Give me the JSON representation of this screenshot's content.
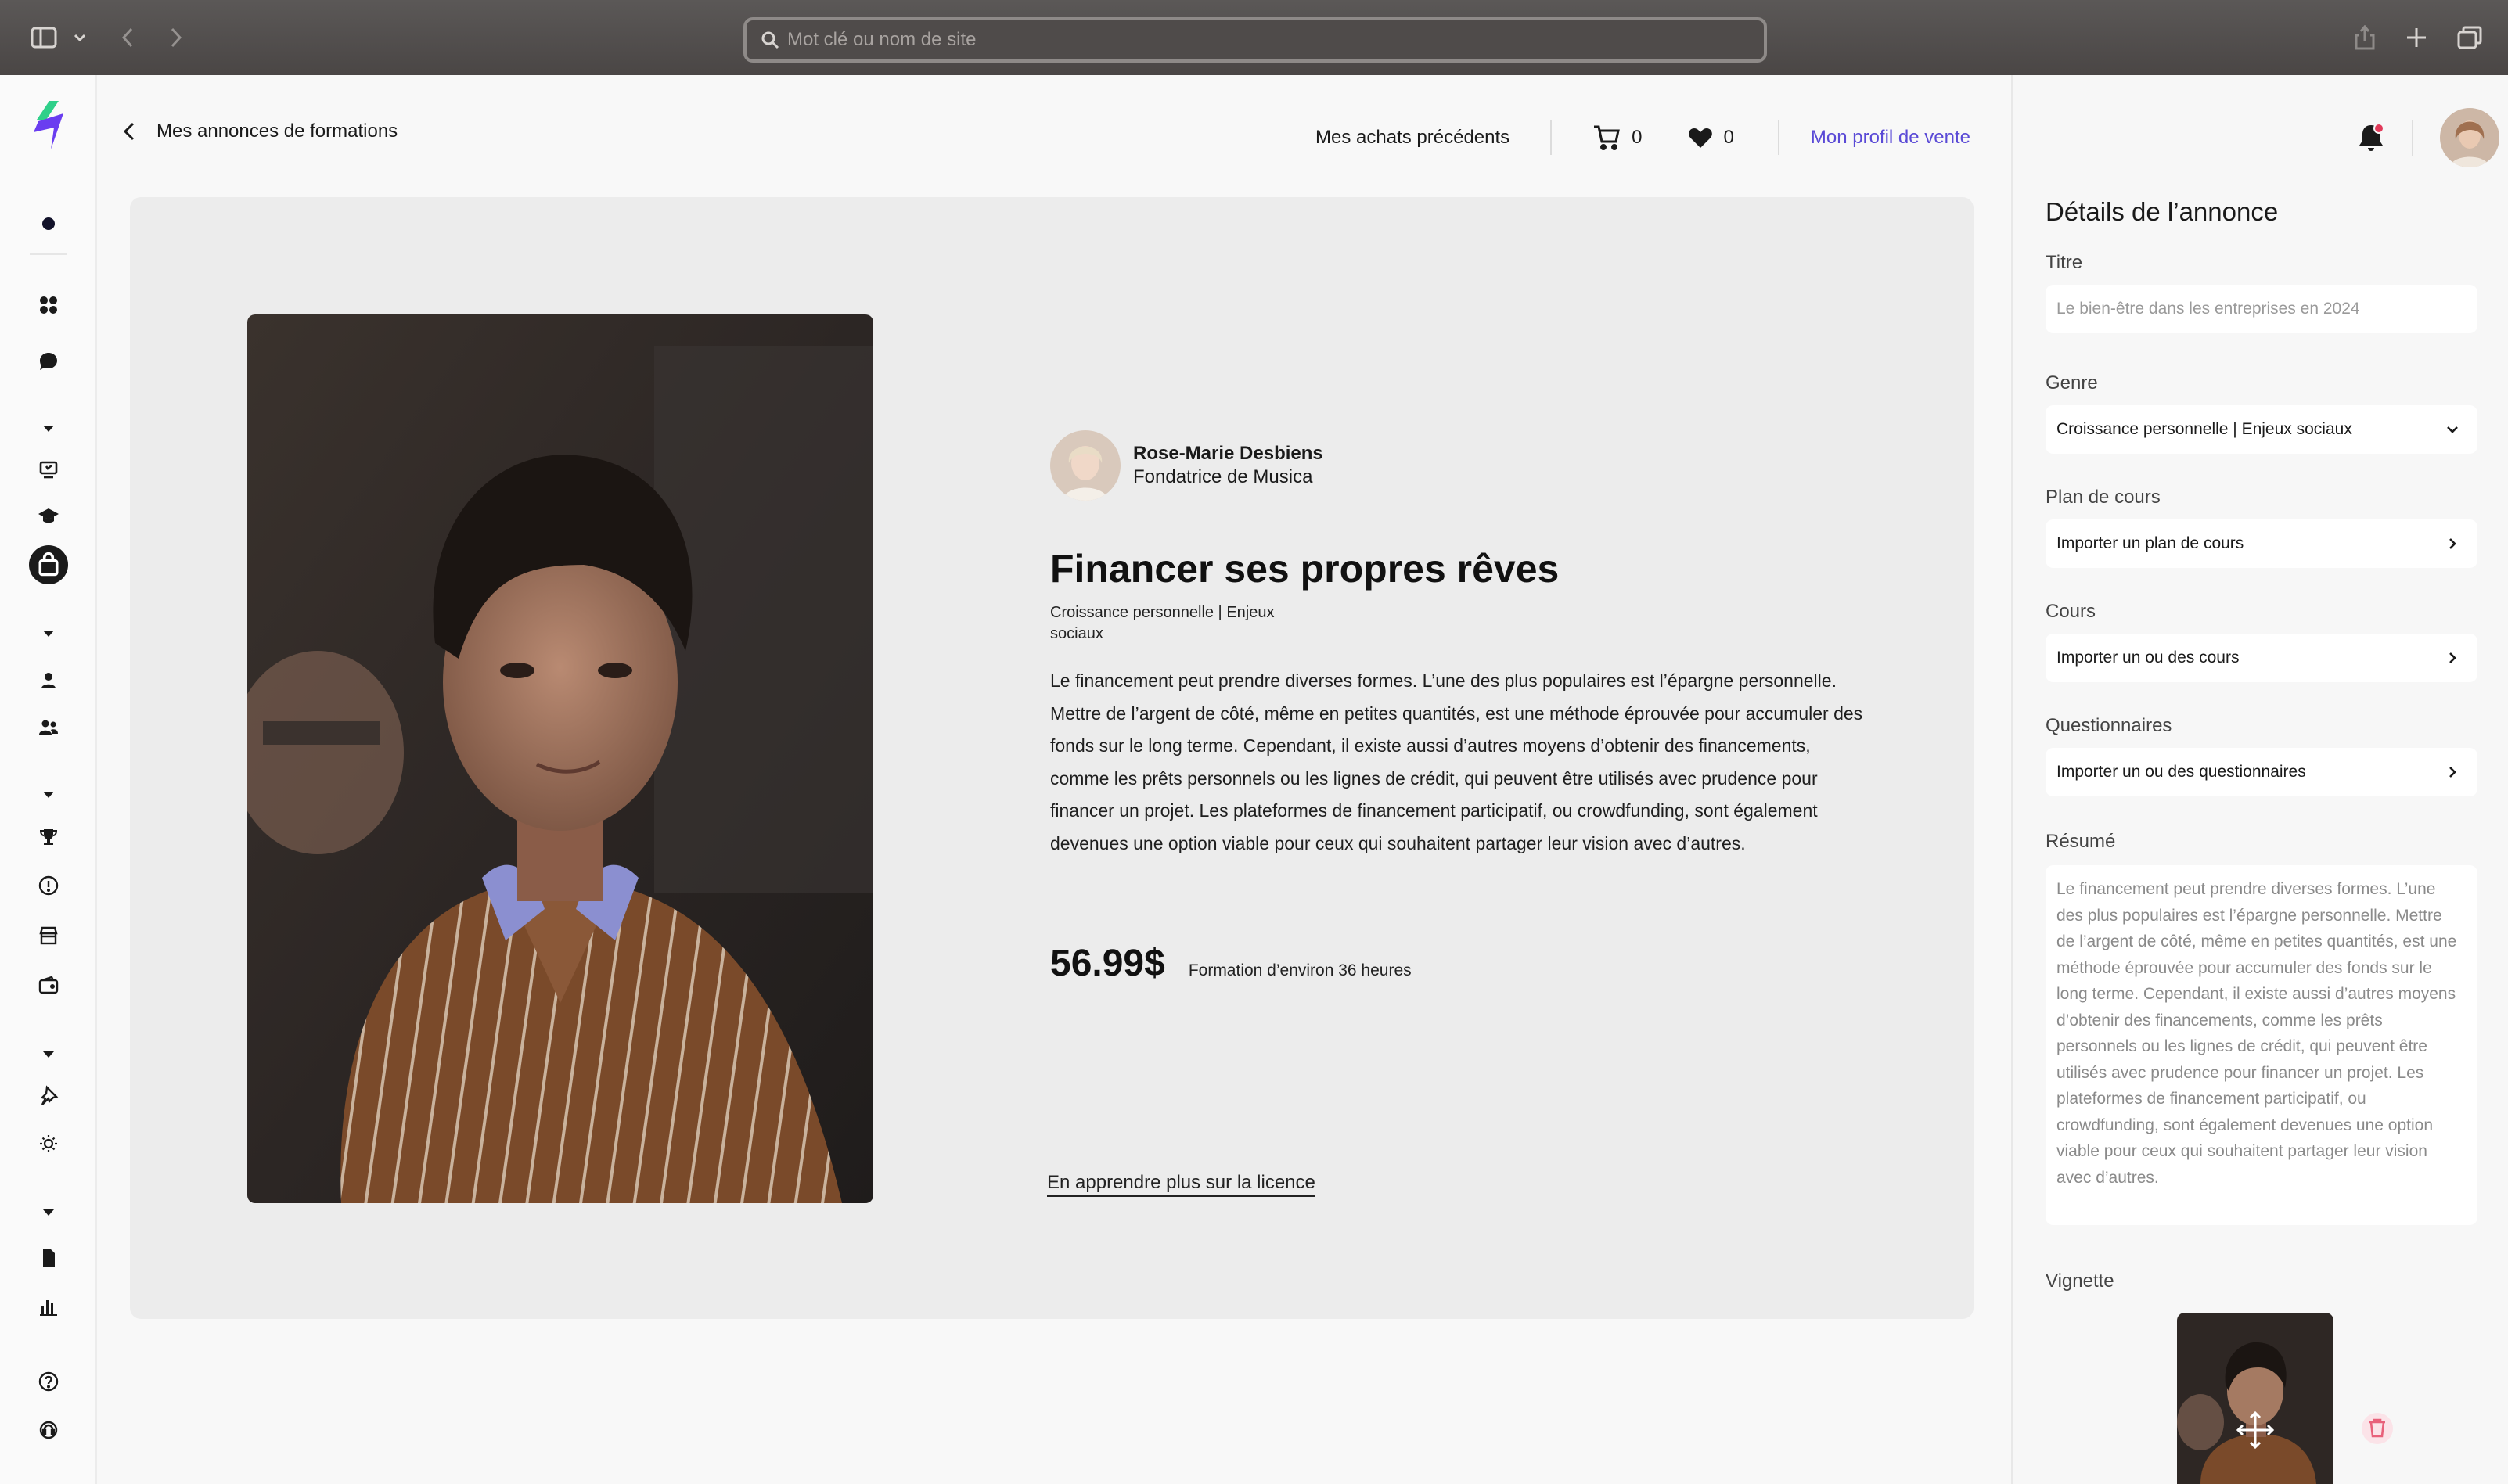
{
  "browser": {
    "url_placeholder": "Mot clé ou nom de site",
    "icons": [
      "sidebar-icon",
      "chevron-down-icon",
      "back-arrow-icon",
      "forward-arrow-icon",
      "share-icon",
      "new-tab-icon",
      "tabs-icon"
    ]
  },
  "rail": {
    "icons": [
      "logo-icon",
      "dot-icon",
      "dashboard-icon",
      "chat-icon",
      "collapse-icon",
      "courses-icon",
      "graduation-icon",
      "shop-icon",
      "collapse-icon",
      "user-icon",
      "group-icon",
      "collapse-icon",
      "trophy-icon",
      "info-icon",
      "store-icon",
      "wallet-icon",
      "collapse-icon",
      "pin-icon",
      "bulb-icon",
      "collapse-icon",
      "document-icon",
      "chart-icon",
      "help-icon",
      "support-icon"
    ]
  },
  "header": {
    "back_label": "Mes annonces de formations",
    "purchases_label": "Mes achats précédents",
    "cart_count": "0",
    "favorites_count": "0",
    "seller_profile_label": "Mon profil de vente"
  },
  "listing": {
    "author_name": "Rose-Marie Desbiens",
    "author_role": "Fondatrice de Musica",
    "title": "Financer ses propres rêves",
    "genre": "Croissance personnelle | Enjeux sociaux",
    "description": "Le financement peut prendre diverses formes. L’une des plus populaires est l’épargne personnelle. Mettre de l’argent de côté, même en petites quantités, est une méthode éprouvée pour accumuler des fonds sur le long terme. Cependant, il existe aussi d’autres moyens d’obtenir des financements, comme les prêts personnels ou les lignes de crédit, qui peuvent être utilisés avec prudence pour financer un projet. Les plateformes de financement participatif, ou crowdfunding, sont également devenues une option viable pour ceux qui souhaitent partager leur vision avec d’autres.",
    "price": "56.99$",
    "duration": "Formation d’environ 36 heures",
    "licence_link": "En apprendre plus sur la licence"
  },
  "panel": {
    "heading": "Détails de l’annonce",
    "title_label": "Titre",
    "title_placeholder": "Le bien-être dans les entreprises en 2024",
    "genre_label": "Genre",
    "genre_value": "Croissance personnelle | Enjeux sociaux",
    "plan_label": "Plan de cours",
    "plan_action": "Importer un plan de cours",
    "courses_label": "Cours",
    "courses_action": "Importer un ou des cours",
    "quiz_label": "Questionnaires",
    "quiz_action": "Importer un ou des questionnaires",
    "summary_label": "Résumé",
    "summary_text": "Le financement peut prendre diverses formes. L’une des plus populaires est l’épargne personnelle. Mettre de l’argent de côté, même en petites quantités, est une méthode éprouvée pour accumuler des fonds sur le long terme. Cependant, il existe aussi d’autres moyens d’obtenir des financements, comme les prêts personnels ou les lignes de crédit, qui peuvent être utilisés avec prudence pour financer un projet. Les plateformes de financement participatif, ou crowdfunding, sont également devenues une option viable pour ceux qui souhaitent partager leur vision avec d’autres.",
    "thumbnail_label": "Vignette"
  },
  "colors": {
    "accent": "#5a4ad6",
    "logo_purple": "#6a3df0",
    "logo_green": "#2fd08a",
    "notification": "#e23a5a",
    "trash": "#e8617a"
  }
}
